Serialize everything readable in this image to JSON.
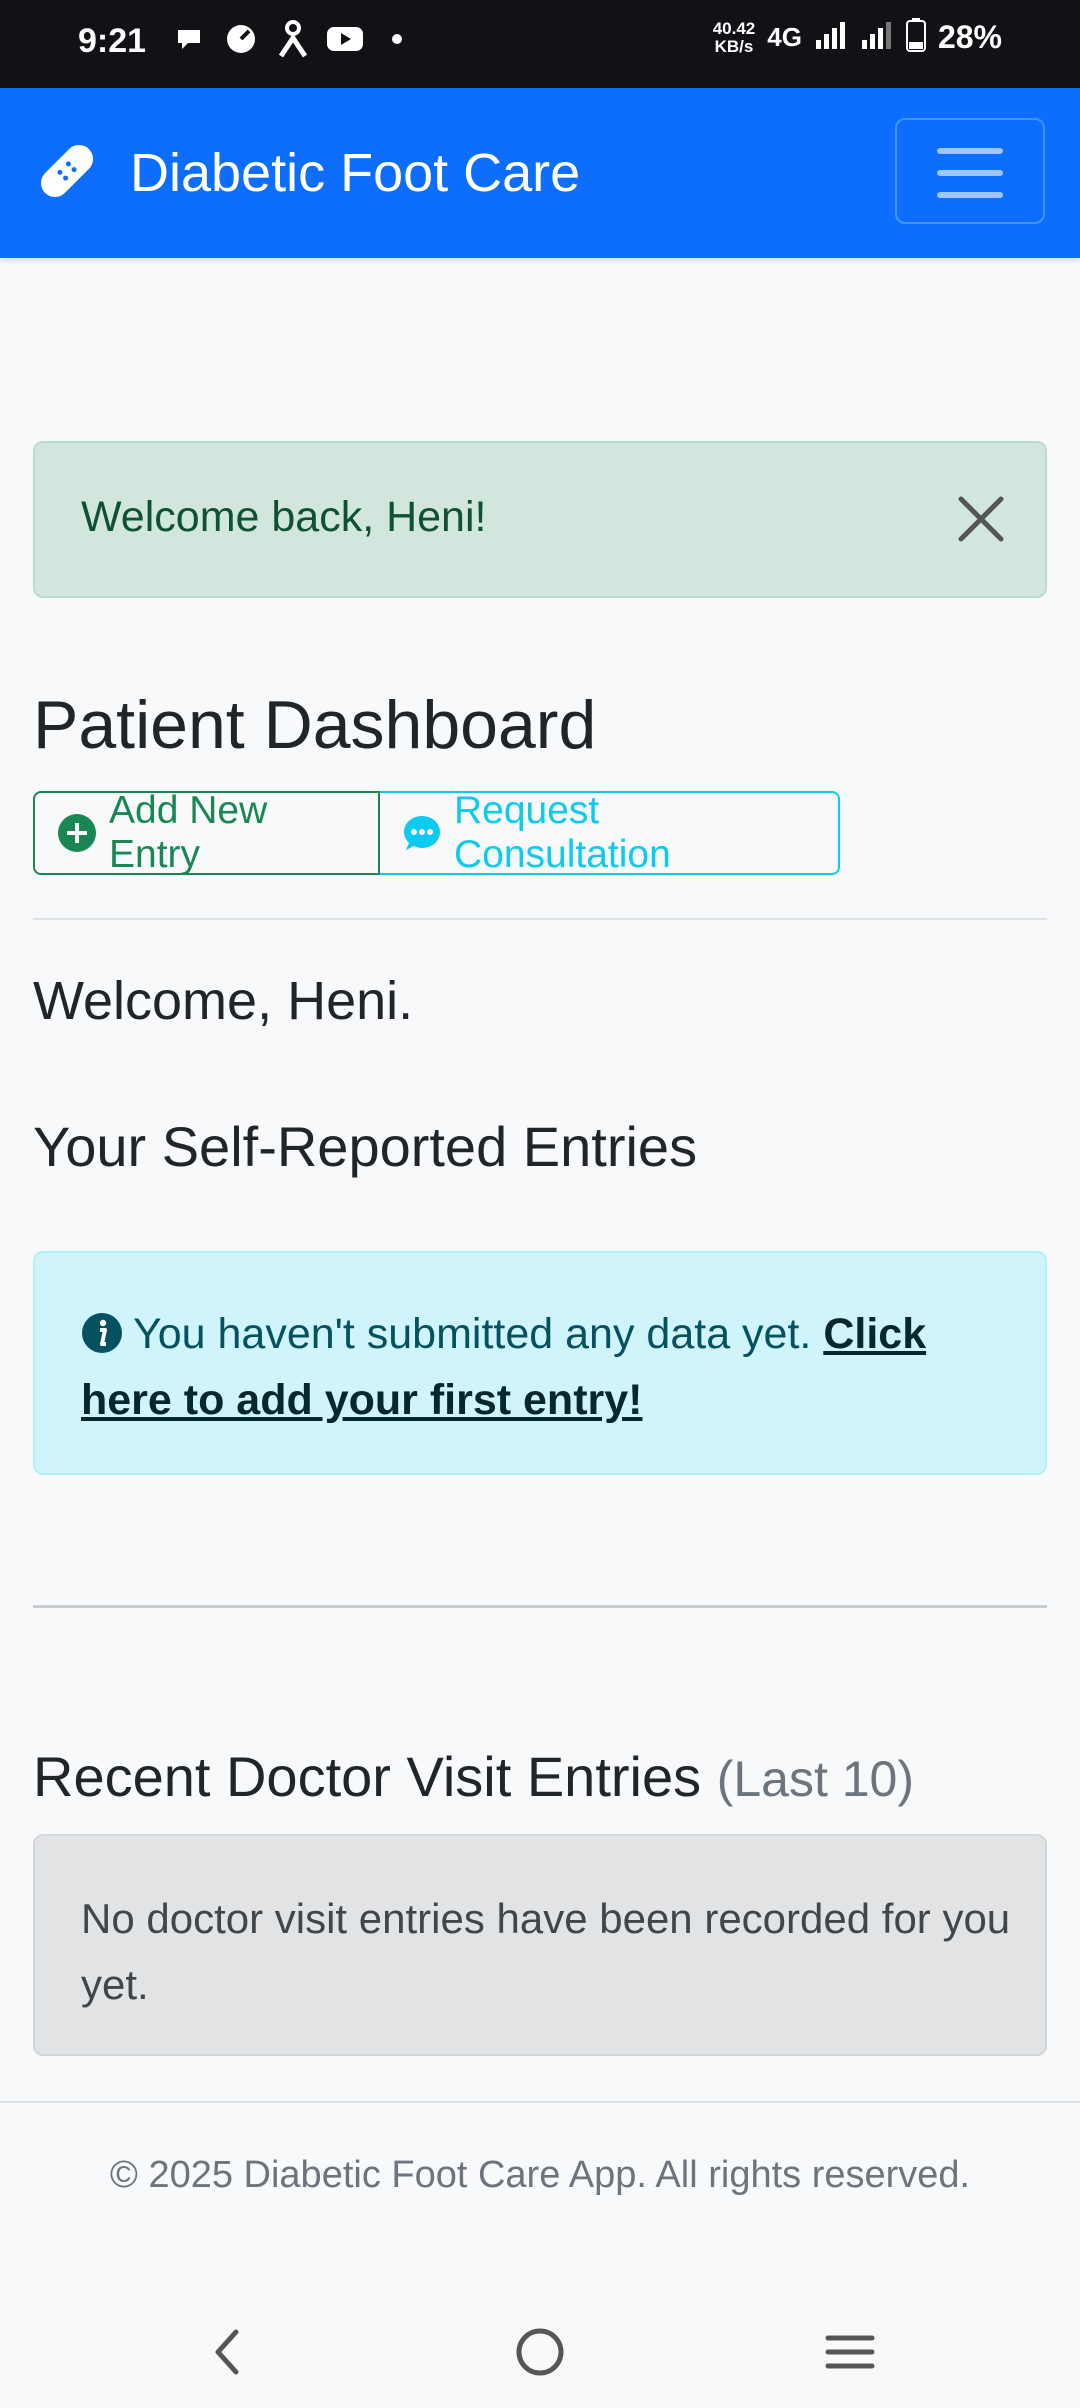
{
  "status_bar": {
    "time": "9:21",
    "speed_value": "40.42",
    "speed_unit": "KB/s",
    "network": "4G",
    "battery": "28%"
  },
  "navbar": {
    "brand": "Diabetic Foot Care",
    "brand_icon": "bandage-icon",
    "menu_icon": "hamburger-icon"
  },
  "flash": {
    "message": "Welcome back, Heni!",
    "close_icon": "close-icon"
  },
  "dashboard": {
    "title": "Patient Dashboard",
    "buttons": {
      "add_entry": "Add New Entry",
      "request_consultation": "Request Consultation"
    },
    "welcome": "Welcome, Heni.",
    "self_reported_title": "Your Self-Reported Entries",
    "no_data_text": "You haven't submitted any data yet.",
    "no_data_link": "Click here to add your first entry!",
    "doctor_visits_title": "Recent Doctor Visit Entries",
    "doctor_visits_suffix": "(Last 10)",
    "no_doctor_visits": "No doctor visit entries have been recorded for you yet."
  },
  "footer": {
    "text": "© 2025 Diabetic Foot Care App. All rights reserved."
  },
  "colors": {
    "primary": "#0d6efd",
    "success": "#198754",
    "info": "#0dcaf0"
  }
}
